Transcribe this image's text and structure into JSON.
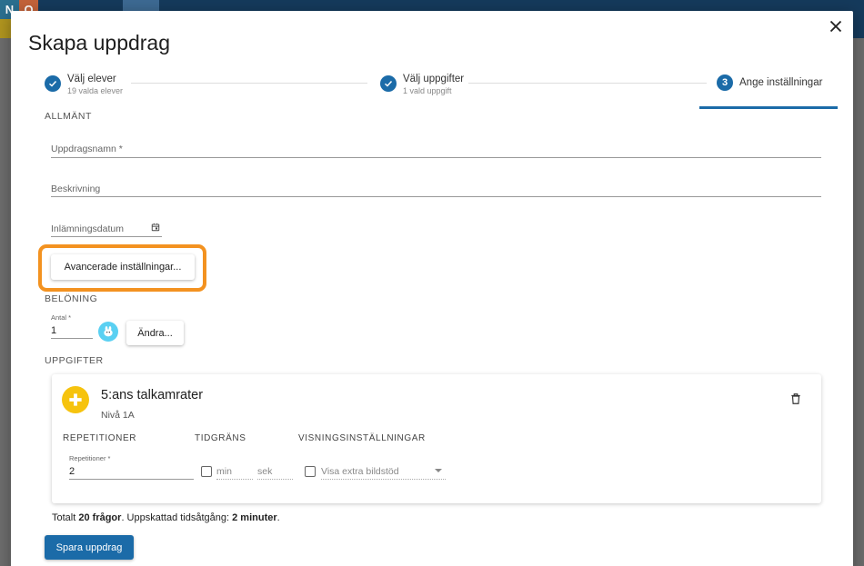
{
  "background": {
    "logo_letters": [
      "N",
      "O",
      "",
      "M"
    ]
  },
  "dialog": {
    "title": "Skapa uppdrag",
    "close_icon": "close-icon"
  },
  "stepper": {
    "steps": [
      {
        "label": "Välj elever",
        "sub": "19 valda elever",
        "state": "done"
      },
      {
        "label": "Välj uppgifter",
        "sub": "1 vald uppgift",
        "state": "done"
      },
      {
        "label": "Ange inställningar",
        "number": "3",
        "state": "active"
      }
    ]
  },
  "general": {
    "section": "ALLMÄNT",
    "name_placeholder": "Uppdragsnamn *",
    "description_placeholder": "Beskrivning",
    "due_date_placeholder": "Inlämningsdatum",
    "advanced_button": "Avancerade inställningar..."
  },
  "reward": {
    "section": "BELÖNING",
    "amount_label": "Antal *",
    "amount_value": "1",
    "change_button": "Ändra..."
  },
  "tasks": {
    "section": "UPPGIFTER",
    "items": [
      {
        "title": "5:ans talkamrater",
        "level": "Nivå 1A",
        "repetitions_head": "REPETITIONER",
        "time_limit_head": "TIDGRÄNS",
        "display_head": "VISNINGSINSTÄLLNINGAR",
        "repetitions_label": "Repetitioner *",
        "repetitions_value": "2",
        "min_placeholder": "min",
        "sec_placeholder": "sek",
        "display_option": "Visa extra bildstöd"
      }
    ]
  },
  "summary": {
    "prefix": "Totalt ",
    "questions": "20 frågor",
    "middle": ". Uppskattad tidsåtgång: ",
    "duration": "2 minuter",
    "suffix": "."
  },
  "save_button": "Spara uppdrag",
  "colors": {
    "primary": "#1b6ba8",
    "highlight": "#f39220",
    "task_icon": "#f6c30e"
  }
}
